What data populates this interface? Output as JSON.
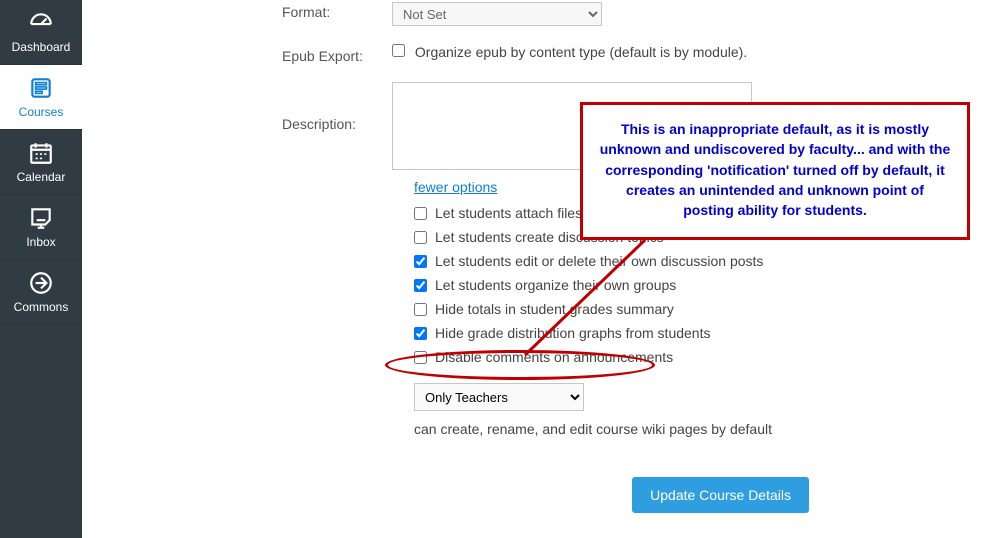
{
  "sidebar": {
    "items": [
      {
        "label": "Dashboard"
      },
      {
        "label": "Courses"
      },
      {
        "label": "Calendar"
      },
      {
        "label": "Inbox"
      },
      {
        "label": "Commons"
      }
    ]
  },
  "form": {
    "format": {
      "label": "Format:",
      "value": "Not Set"
    },
    "epub": {
      "label": "Epub Export:",
      "option": "Organize epub by content type (default is by module)."
    },
    "description": {
      "label": "Description:"
    },
    "fewer_options": "fewer options",
    "options": [
      {
        "label": "Let students attach files to discussions",
        "checked": false
      },
      {
        "label": "Let students create discussion topics",
        "checked": false
      },
      {
        "label": "Let students edit or delete their own discussion posts",
        "checked": true
      },
      {
        "label": "Let students organize their own groups",
        "checked": true
      },
      {
        "label": "Hide totals in student grades summary",
        "checked": false
      },
      {
        "label": "Hide grade distribution graphs from students",
        "checked": true
      },
      {
        "label": "Disable comments on announcements",
        "checked": false
      }
    ],
    "permission_select": "Only Teachers",
    "permission_caption": "can create, rename, and edit course wiki pages by default",
    "update_button": "Update Course Details"
  },
  "annotation": {
    "text": "This is an inappropriate default, as it is mostly unknown and undiscovered by faculty... and with the corresponding 'notification' turned off by default, it creates an unintended and unknown point of posting ability for students."
  }
}
